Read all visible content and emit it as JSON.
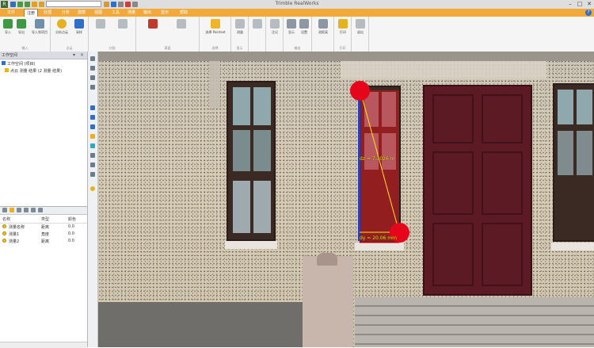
{
  "app": {
    "title": "Trimble RealWorks",
    "quick_access_dropdown": "",
    "window_buttons": [
      "–",
      "□",
      "✕"
    ]
  },
  "tabs": [
    "文件",
    "注册",
    "处理",
    "分析",
    "建模",
    "视图",
    "工具",
    "测量",
    "输出",
    "显示",
    "帮助"
  ],
  "ribbon": {
    "groups": [
      {
        "label": "输入",
        "buttons": [
          "导入",
          "导出",
          "导入到项目"
        ]
      },
      {
        "label": "点云",
        "buttons": [
          "分析点云",
          "采样"
        ]
      },
      {
        "label": "分割",
        "buttons": [
          "",
          ""
        ]
      },
      {
        "label": "表面",
        "buttons": [
          "",
          ""
        ]
      },
      {
        "label": "选择",
        "buttons": [
          "选择 Pointset"
        ]
      },
      {
        "label": "显示",
        "buttons": [
          "测量"
        ]
      },
      {
        "label": "",
        "buttons": [
          "",
          ""
        ]
      },
      {
        "label": "",
        "buttons": [
          "注记"
        ]
      },
      {
        "label": "输出",
        "buttons": [
          "显示",
          "设置"
        ]
      },
      {
        "label": "",
        "buttons": [
          "测距离"
        ]
      },
      {
        "label": "打印",
        "buttons": [
          "打印"
        ]
      },
      {
        "label": "",
        "buttons": [
          "退出"
        ]
      }
    ]
  },
  "left_panel": {
    "title": "工作空间",
    "controls": [
      "▾",
      "×"
    ],
    "tree": [
      {
        "label": "工作空间 (项目)"
      },
      {
        "label": "点云 测量 结果 (2 测量 结果)"
      }
    ]
  },
  "list_panel": {
    "columns": [
      "名称",
      "类型",
      "颜色"
    ],
    "rows": [
      {
        "name": "测量名称",
        "type": "距离",
        "value": "0.0"
      },
      {
        "name": "测量1",
        "type": "角度",
        "value": "0.0"
      },
      {
        "name": "测量2",
        "type": "距离",
        "value": "0.0"
      }
    ]
  },
  "measurement": {
    "dz_label": "dz = 7.3026 m",
    "dy_label": "dy = 20.06 mm",
    "colors": {
      "fill": "#dc141e",
      "point": "#e6061b",
      "label": "#ffe21a",
      "edge": "#2e3db0"
    }
  },
  "colors": {
    "accent": "#f3a93a",
    "ribbon_bg": "#f5f5f5",
    "door": "#5b1a24"
  }
}
